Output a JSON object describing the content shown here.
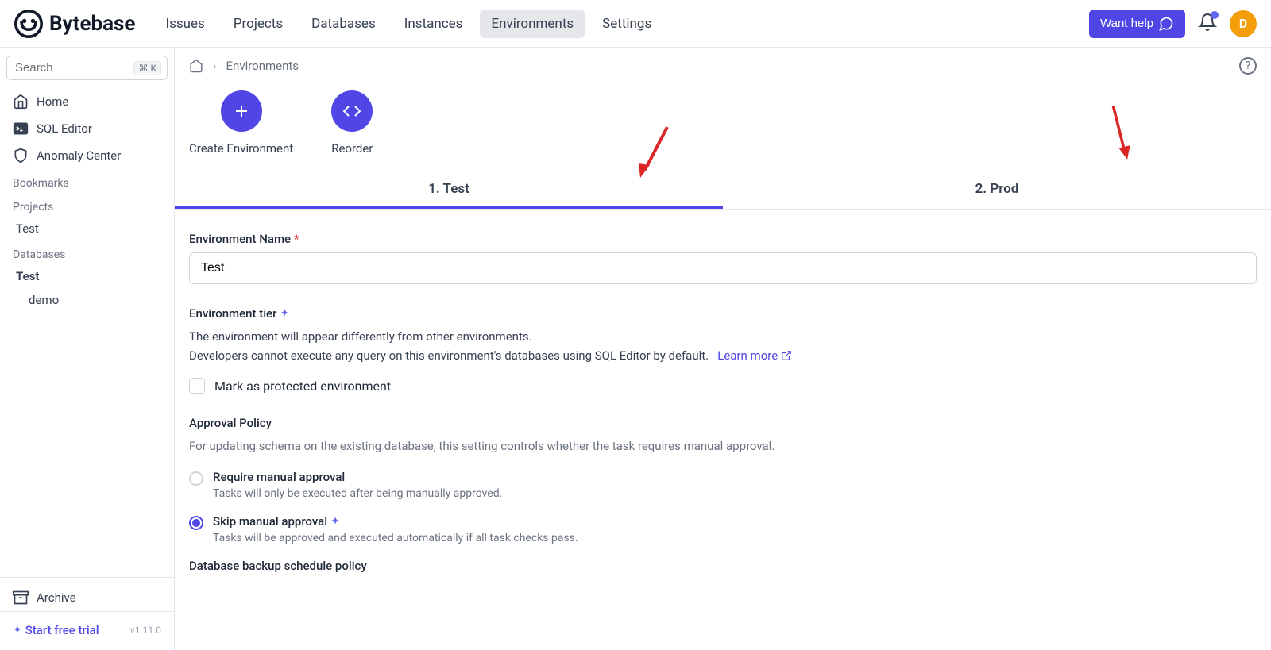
{
  "brand": "Bytebase",
  "nav": {
    "issues": "Issues",
    "projects": "Projects",
    "databases": "Databases",
    "instances": "Instances",
    "environments": "Environments",
    "settings": "Settings"
  },
  "header": {
    "help": "Want help",
    "avatar_initial": "D"
  },
  "sidebar": {
    "search_placeholder": "Search",
    "search_kbd": "⌘ K",
    "home": "Home",
    "sql_editor": "SQL Editor",
    "anomaly_center": "Anomaly Center",
    "bookmarks": "Bookmarks",
    "projects": "Projects",
    "project_test": "Test",
    "databases": "Databases",
    "db_test": "Test",
    "db_demo": "demo",
    "archive": "Archive",
    "trial": "Start free trial",
    "version": "v1.11.0"
  },
  "breadcrumb": {
    "environments": "Environments"
  },
  "actions": {
    "create": "Create Environment",
    "reorder": "Reorder"
  },
  "tabs": {
    "test": "1. Test",
    "prod": "2. Prod"
  },
  "form": {
    "name_label": "Environment Name",
    "name_value": "Test",
    "tier_label": "Environment tier",
    "tier_desc1": "The environment will appear differently from other environments.",
    "tier_desc2": "Developers cannot execute any query on this environment's databases using SQL Editor by default.",
    "learn_more": "Learn more",
    "protect_label": "Mark as protected environment",
    "approval_label": "Approval Policy",
    "approval_desc": "For updating schema on the existing database, this setting controls whether the task requires manual approval.",
    "require_label": "Require manual approval",
    "require_desc": "Tasks will only be executed after being manually approved.",
    "skip_label": "Skip manual approval",
    "skip_desc": "Tasks will be approved and executed automatically if all task checks pass.",
    "backup_label": "Database backup schedule policy"
  }
}
